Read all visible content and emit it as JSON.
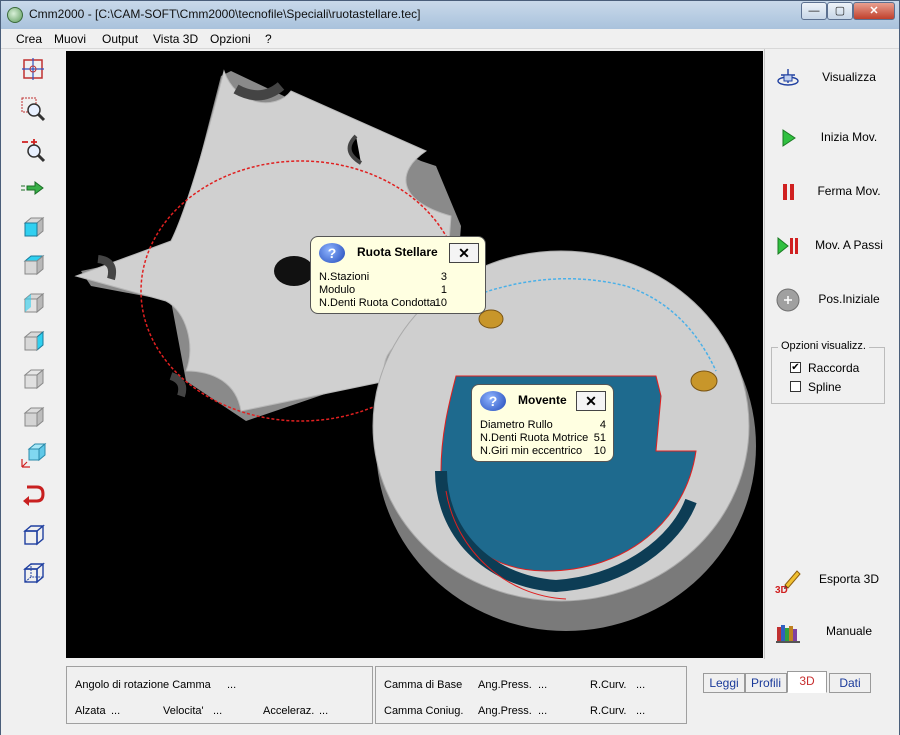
{
  "window": {
    "title": "Cmm2000 - [C:\\CAM-SOFT\\Cmm2000\\tecnofile\\Speciali\\ruotastellare.tec]",
    "min_glyph": "—",
    "max_glyph": "▢",
    "close_glyph": "✕"
  },
  "menu": [
    "Crea",
    "Muovi",
    "Output",
    "Vista 3D",
    "Opzioni",
    "?"
  ],
  "toolbar_icons": [
    "center-view-icon",
    "zoom-window-icon",
    "zoom-in-out-icon",
    "pan-arrow-icon",
    "view-front-icon",
    "view-top-icon",
    "view-side-icon",
    "view-right-icon",
    "view-left-icon",
    "view-back-icon",
    "view-iso-icon",
    "rotate-view-icon",
    "solid-cube-icon",
    "wireframe-cube-icon"
  ],
  "right_panel": {
    "buttons": [
      {
        "label": "Visualizza",
        "icon": "visualize-icon"
      },
      {
        "label": "Inizia Mov.",
        "icon": "play-icon"
      },
      {
        "label": "Ferma Mov.",
        "icon": "pause-icon"
      },
      {
        "label": "Mov. A Passi",
        "icon": "step-icon"
      },
      {
        "label": "Pos.Iniziale",
        "icon": "home-position-icon"
      }
    ],
    "options_group": {
      "title": "Opzioni visualizz.",
      "raccorda": {
        "label": "Raccorda",
        "checked": true,
        "mark": "✔"
      },
      "spline": {
        "label": "Spline",
        "checked": false
      }
    },
    "export": {
      "label": "Esporta 3D",
      "icon": "export-3d-icon",
      "badge": "3D"
    },
    "manual": {
      "label": "Manuale",
      "icon": "manual-books-icon"
    }
  },
  "tooltip_ruota": {
    "title": "Ruota Stellare",
    "close": "✕",
    "q": "?",
    "rows": [
      {
        "label": "N.Stazioni",
        "value": "3"
      },
      {
        "label": "Modulo",
        "value": "1"
      },
      {
        "label": "N.Denti Ruota Condotta",
        "value": "10"
      }
    ]
  },
  "tooltip_movente": {
    "title": "Movente",
    "close": "✕",
    "q": "?",
    "rows": [
      {
        "label": "Diametro Rullo",
        "value": "4"
      },
      {
        "label": "N.Denti Ruota Motrice",
        "value": "51"
      },
      {
        "label": "N.Giri min eccentrico",
        "value": "10"
      }
    ]
  },
  "status": {
    "angolo_label": "Angolo di rotazione Camma",
    "angolo_value": "...",
    "alzata_label": "Alzata",
    "alzata_value": "...",
    "velocita_label": "Velocita'",
    "velocita_value": "...",
    "acceleraz_label": "Acceleraz.",
    "acceleraz_value": "...",
    "camma_base_label": "Camma di Base",
    "camma_coniug_label": "Camma Coniug.",
    "ang_press_label": "Ang.Press.",
    "ang_press_1": "...",
    "ang_press_2": "...",
    "r_curv_label": "R.Curv.",
    "r_curv_1": "...",
    "r_curv_2": "..."
  },
  "tabs": [
    {
      "label": "Leggi",
      "active": false
    },
    {
      "label": "Profili",
      "active": false
    },
    {
      "label": "3D",
      "active": true
    },
    {
      "label": "Dati",
      "active": false
    }
  ]
}
